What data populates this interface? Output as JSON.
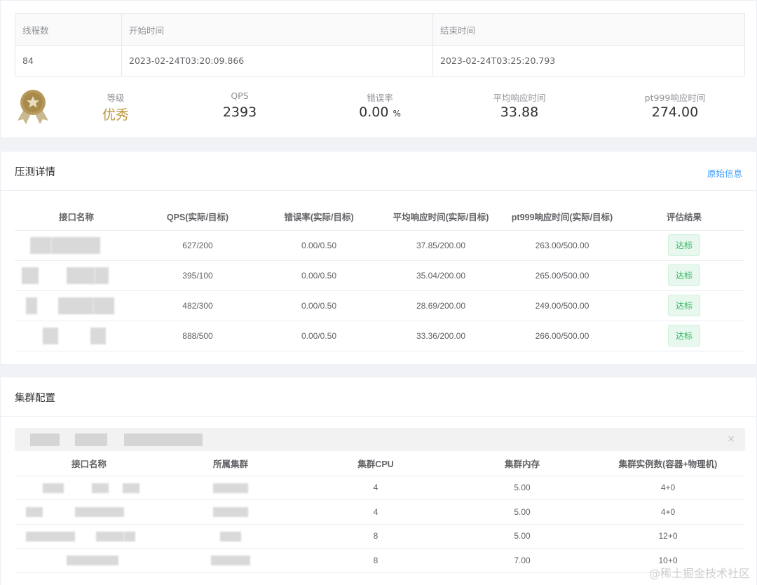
{
  "summary": {
    "headers": [
      "线程数",
      "开始时间",
      "结束时间"
    ],
    "values": [
      "84",
      "2023-02-24T03:20:09.866",
      "2023-02-24T03:25:20.793"
    ],
    "stats": {
      "grade_label": "等级",
      "grade_value": "优秀",
      "qps_label": "QPS",
      "qps_value": "2393",
      "error_label": "错误率",
      "error_value": "0.00",
      "error_unit": "%",
      "avg_label": "平均响应时间",
      "avg_value": "33.88",
      "pt999_label": "pt999响应时间",
      "pt999_value": "274.00"
    }
  },
  "detail": {
    "title": "压测详情",
    "link": "原始信息",
    "columns": [
      "接口名称",
      "QPS(实际/目标)",
      "错误率(实际/目标)",
      "平均响应时间(实际/目标)",
      "pt999响应时间(实际/目标)",
      "评估结果"
    ],
    "rows": [
      {
        "qps": "627/200",
        "err": "0.00/0.50",
        "avg": "37.85/200.00",
        "pt999": "263.00/500.00",
        "result": "达标"
      },
      {
        "qps": "395/100",
        "err": "0.00/0.50",
        "avg": "35.04/200.00",
        "pt999": "265.00/500.00",
        "result": "达标"
      },
      {
        "qps": "482/300",
        "err": "0.00/0.50",
        "avg": "28.69/200.00",
        "pt999": "249.00/500.00",
        "result": "达标"
      },
      {
        "qps": "888/500",
        "err": "0.00/0.50",
        "avg": "33.36/200.00",
        "pt999": "266.00/500.00",
        "result": "达标"
      }
    ]
  },
  "cluster": {
    "title": "集群配置",
    "close_icon": "×",
    "columns": [
      "接口名称",
      "所属集群",
      "集群CPU",
      "集群内存",
      "集群实例数(容器+物理机)"
    ],
    "rows": [
      {
        "cpu": "4",
        "mem": "5.00",
        "inst": "4+0"
      },
      {
        "cpu": "4",
        "mem": "5.00",
        "inst": "4+0"
      },
      {
        "cpu": "8",
        "mem": "5.00",
        "inst": "12+0"
      },
      {
        "cpu": "8",
        "mem": "7.00",
        "inst": "10+0"
      }
    ]
  },
  "watermark": "@稀土掘金技术社区",
  "colors": {
    "accent": "#409eff",
    "gold": "#b8973c",
    "success": "#2fb65f"
  }
}
